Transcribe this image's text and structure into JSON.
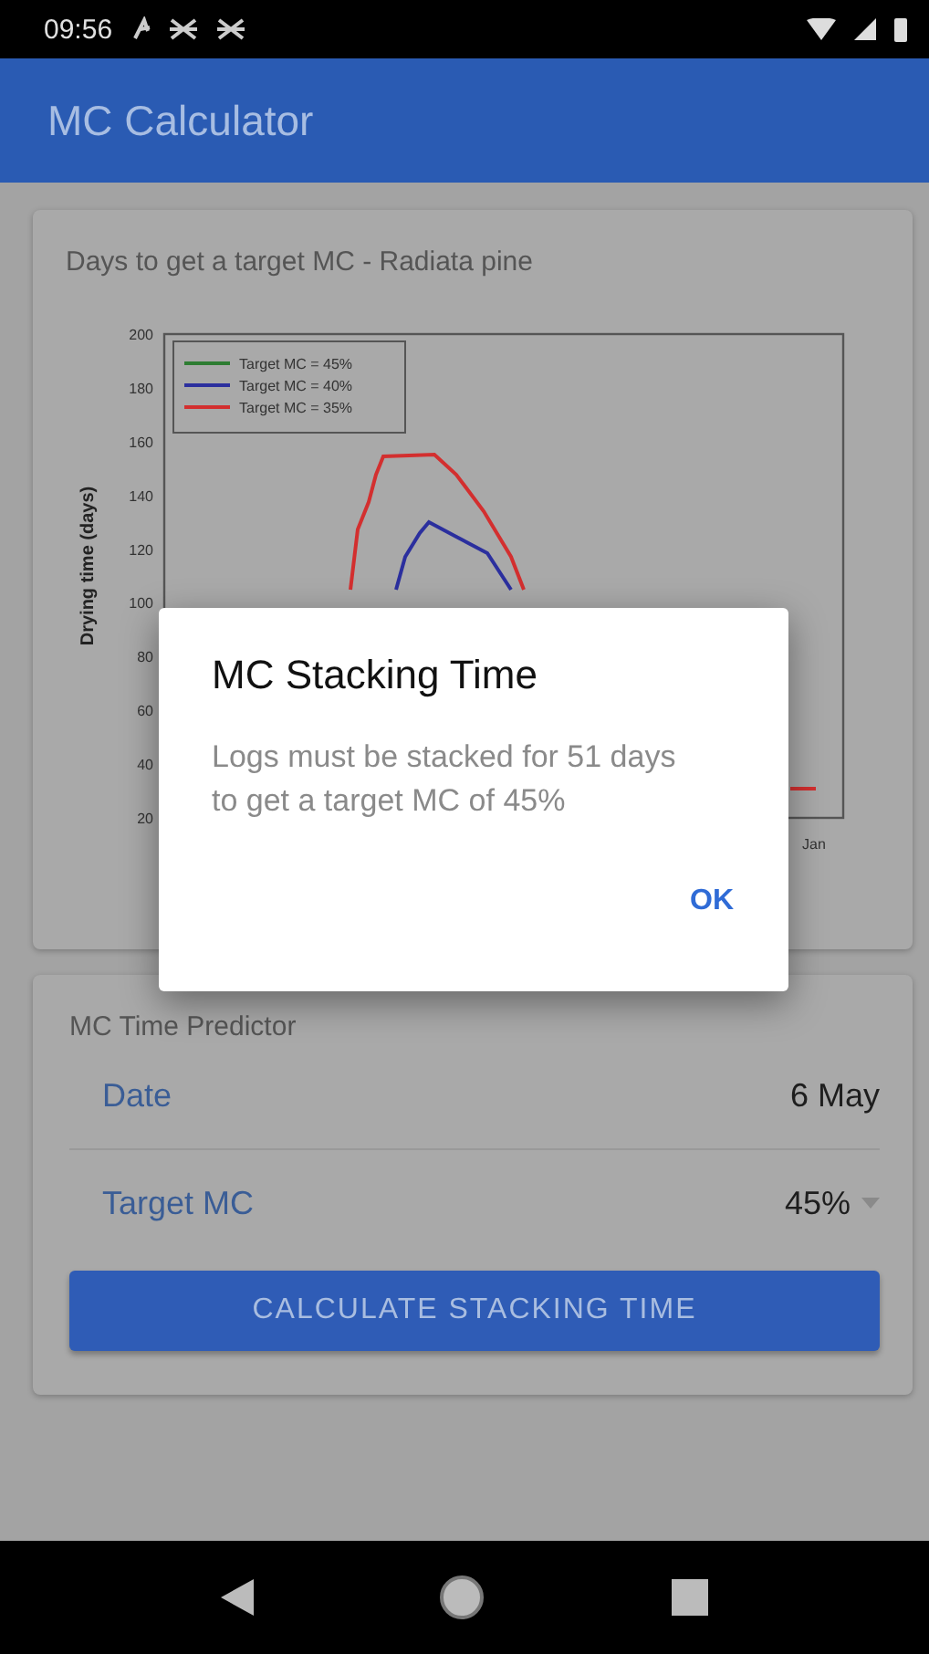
{
  "status_bar": {
    "time": "09:56"
  },
  "app_bar": {
    "title": "MC Calculator"
  },
  "chart_card": {
    "title": "Days to get a target MC - Radiata pine",
    "y_axis_label": "Drying time (days)",
    "y_tick_labels": [
      "200",
      "180",
      "160",
      "140",
      "120",
      "100",
      "80",
      "60",
      "40",
      "20"
    ],
    "x_tick_labels": [
      "Jan"
    ],
    "legend": [
      {
        "label": "Target MC = 45%",
        "color": "#2e7d32"
      },
      {
        "label": "Target MC = 40%",
        "color": "#2b2f9e"
      },
      {
        "label": "Target MC = 35%",
        "color": "#d32f2f"
      }
    ]
  },
  "predictor_card": {
    "title": "MC Time Predictor",
    "rows": [
      {
        "kind": "date",
        "label": "Date",
        "value": "6 May"
      },
      {
        "kind": "dropdown",
        "label": "Target MC",
        "value": "45%"
      }
    ],
    "button": "CALCULATE STACKING TIME"
  },
  "dialog": {
    "title": "MC Stacking Time",
    "message": "Logs must be stacked for 51 days to get a target MC of 45%",
    "button": "OK"
  }
}
